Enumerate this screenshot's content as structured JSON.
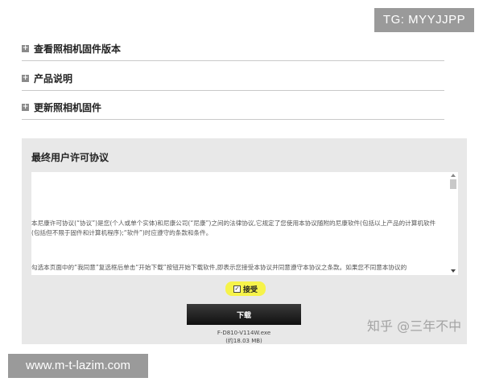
{
  "watermarks": {
    "tg": "TG: MYYJJPP",
    "url": "www.m-t-lazim.com",
    "zhihu": "知乎 @三年不中"
  },
  "accordion": {
    "icon": "plus-square-icon",
    "items": [
      {
        "label": "查看照相机固件版本"
      },
      {
        "label": "产品说明"
      },
      {
        "label": "更新照相机固件"
      }
    ]
  },
  "eula": {
    "title": "最终用户许可协议",
    "paragraph1": "本尼康许可协议(“协议”)是您(个人或单个实体)和尼康公司(“尼康”)之间的法律协议,它规定了您使用本协议随附的尼康软件(包括以上产品的计算机软件(包括但不限于固件和计算机程序);“软件”)时应遵守的条款和条件。",
    "paragraph2": "勾选本页面中的“我同意”复选框后单击“开始下载”按钮开始下载软件,即表示您接受本协议并同意遵守本协议之条款。如果您不同意本协议的"
  },
  "accept": {
    "label": "接受",
    "checked": true,
    "highlight_color": "#f6f34a"
  },
  "download": {
    "button_label": "下载",
    "file_name": "F-D810-V114W.exe",
    "file_size": "(约18.03 MB)"
  }
}
